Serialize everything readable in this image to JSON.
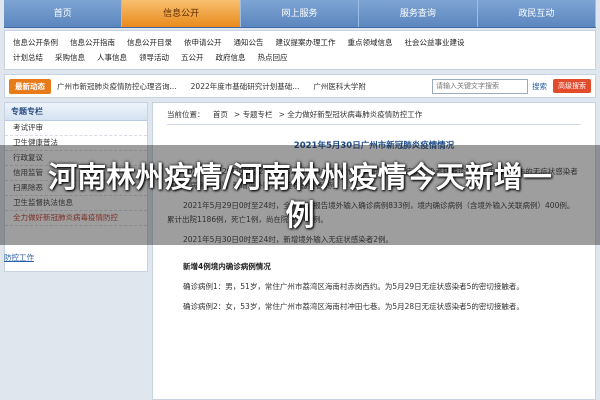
{
  "top_nav": [
    "首页",
    "信息公开",
    "网上服务",
    "服务查询",
    "政民互动"
  ],
  "sub_nav": {
    "row1": [
      "信息公开条例",
      "信息公开指南",
      "信息公开目录",
      "依申请公开",
      "通知公告",
      "建议提案办理工作",
      "重点领域信息",
      "社会公益事业建设"
    ],
    "row2": [
      "计划总结",
      "采购信息",
      "人事信息",
      "领导活动",
      "五公开",
      "政府信息",
      "热点回应"
    ]
  },
  "update_bar": {
    "label": "最新动态",
    "items": [
      "广州市新冠肺炎疫情防控心理咨询...",
      "2022年度市基础研究计划基础...",
      "广州医科大学附"
    ],
    "search_placeholder": "请输入关键文字搜索",
    "search_button": "搜索",
    "advanced": "高级搜索"
  },
  "sidebar": {
    "title": "专题专栏",
    "items": [
      "考试评审",
      "卫生健康普法",
      "行政复议",
      "信用监管",
      "扫黑除恶",
      "卫生监督执法信息",
      "全力做好新冠肺炎病毒疫情防控"
    ],
    "back": "防控工作"
  },
  "breadcrumb": {
    "prefix": "当前位置：",
    "items": [
      "首页",
      "专题专栏",
      "全力做好新型冠状病毒肺炎疫情防控工作"
    ]
  },
  "article": {
    "title": "2021年5月30日广州市新冠肺炎疫情情况",
    "p1": "2021年5月29日0时至24时，新增境内确诊病例2例（其中1例为无症状感染者转确诊病例，由此已公布的无症状感染者转确诊病例14例），新增境外输入无症状感染者2例。",
    "p2": "2021年5月29日0时至24时，全市累计报告境外输入确诊病例833例，境内确诊病例（含境外输入关联病例）400例。累计出院1186例，死亡1例，尚在院治疗46例。",
    "p3": "2021年5月30日0时至24时，新增境外输入无症状感染者2例。",
    "subhead": "新增4例境内确诊病例情况",
    "case1": "确诊病例1：男，51岁，常住广州市荔湾区海南村赤岗西约。为5月29日无症状感染者5的密切接触者。",
    "case2": "确诊病例2：女，53岁，常住广州市荔湾区海南村冲田七巷。为5月28日无症状感染者5的密切接触者。"
  },
  "overlay_title": "河南林州疫情/河南林州疫情今天新增一例",
  "colors": {
    "nav_blue": "#5b86bf",
    "nav_active": "#e88a1c",
    "title_blue": "#1b4b8a"
  }
}
